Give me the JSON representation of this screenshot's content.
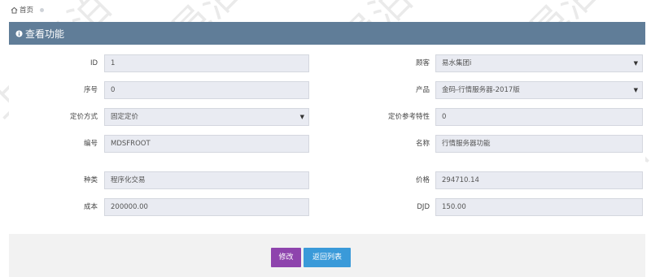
{
  "breadcrumb": {
    "home_label": "首页"
  },
  "panel": {
    "title": "查看功能"
  },
  "fields": {
    "id": {
      "label": "ID",
      "value": "1"
    },
    "customer": {
      "label": "顾客",
      "value": "易水集团i"
    },
    "seq": {
      "label": "序号",
      "value": "0"
    },
    "product": {
      "label": "产品",
      "value": "金码-行情服务器-2017版"
    },
    "pricing_method": {
      "label": "定价方式",
      "value": "固定定价"
    },
    "pricing_ref": {
      "label": "定价参考特性",
      "value": "0"
    },
    "code": {
      "label": "编号",
      "value": "MDSFROOT"
    },
    "name": {
      "label": "名称",
      "value": "行情服务器功能"
    },
    "kind": {
      "label": "种类",
      "value": "程序化交易"
    },
    "price": {
      "label": "价格",
      "value": "294710.14"
    },
    "cost": {
      "label": "成本",
      "value": "200000.00"
    },
    "djd": {
      "label": "DJD",
      "value": "150.00"
    }
  },
  "buttons": {
    "edit": "修改",
    "back": "返回列表"
  },
  "watermark": "上海邑泊",
  "colors": {
    "header": "#607d98",
    "edit": "#8e44ad",
    "back": "#3a9ad9",
    "field": "#e9ebf2"
  }
}
